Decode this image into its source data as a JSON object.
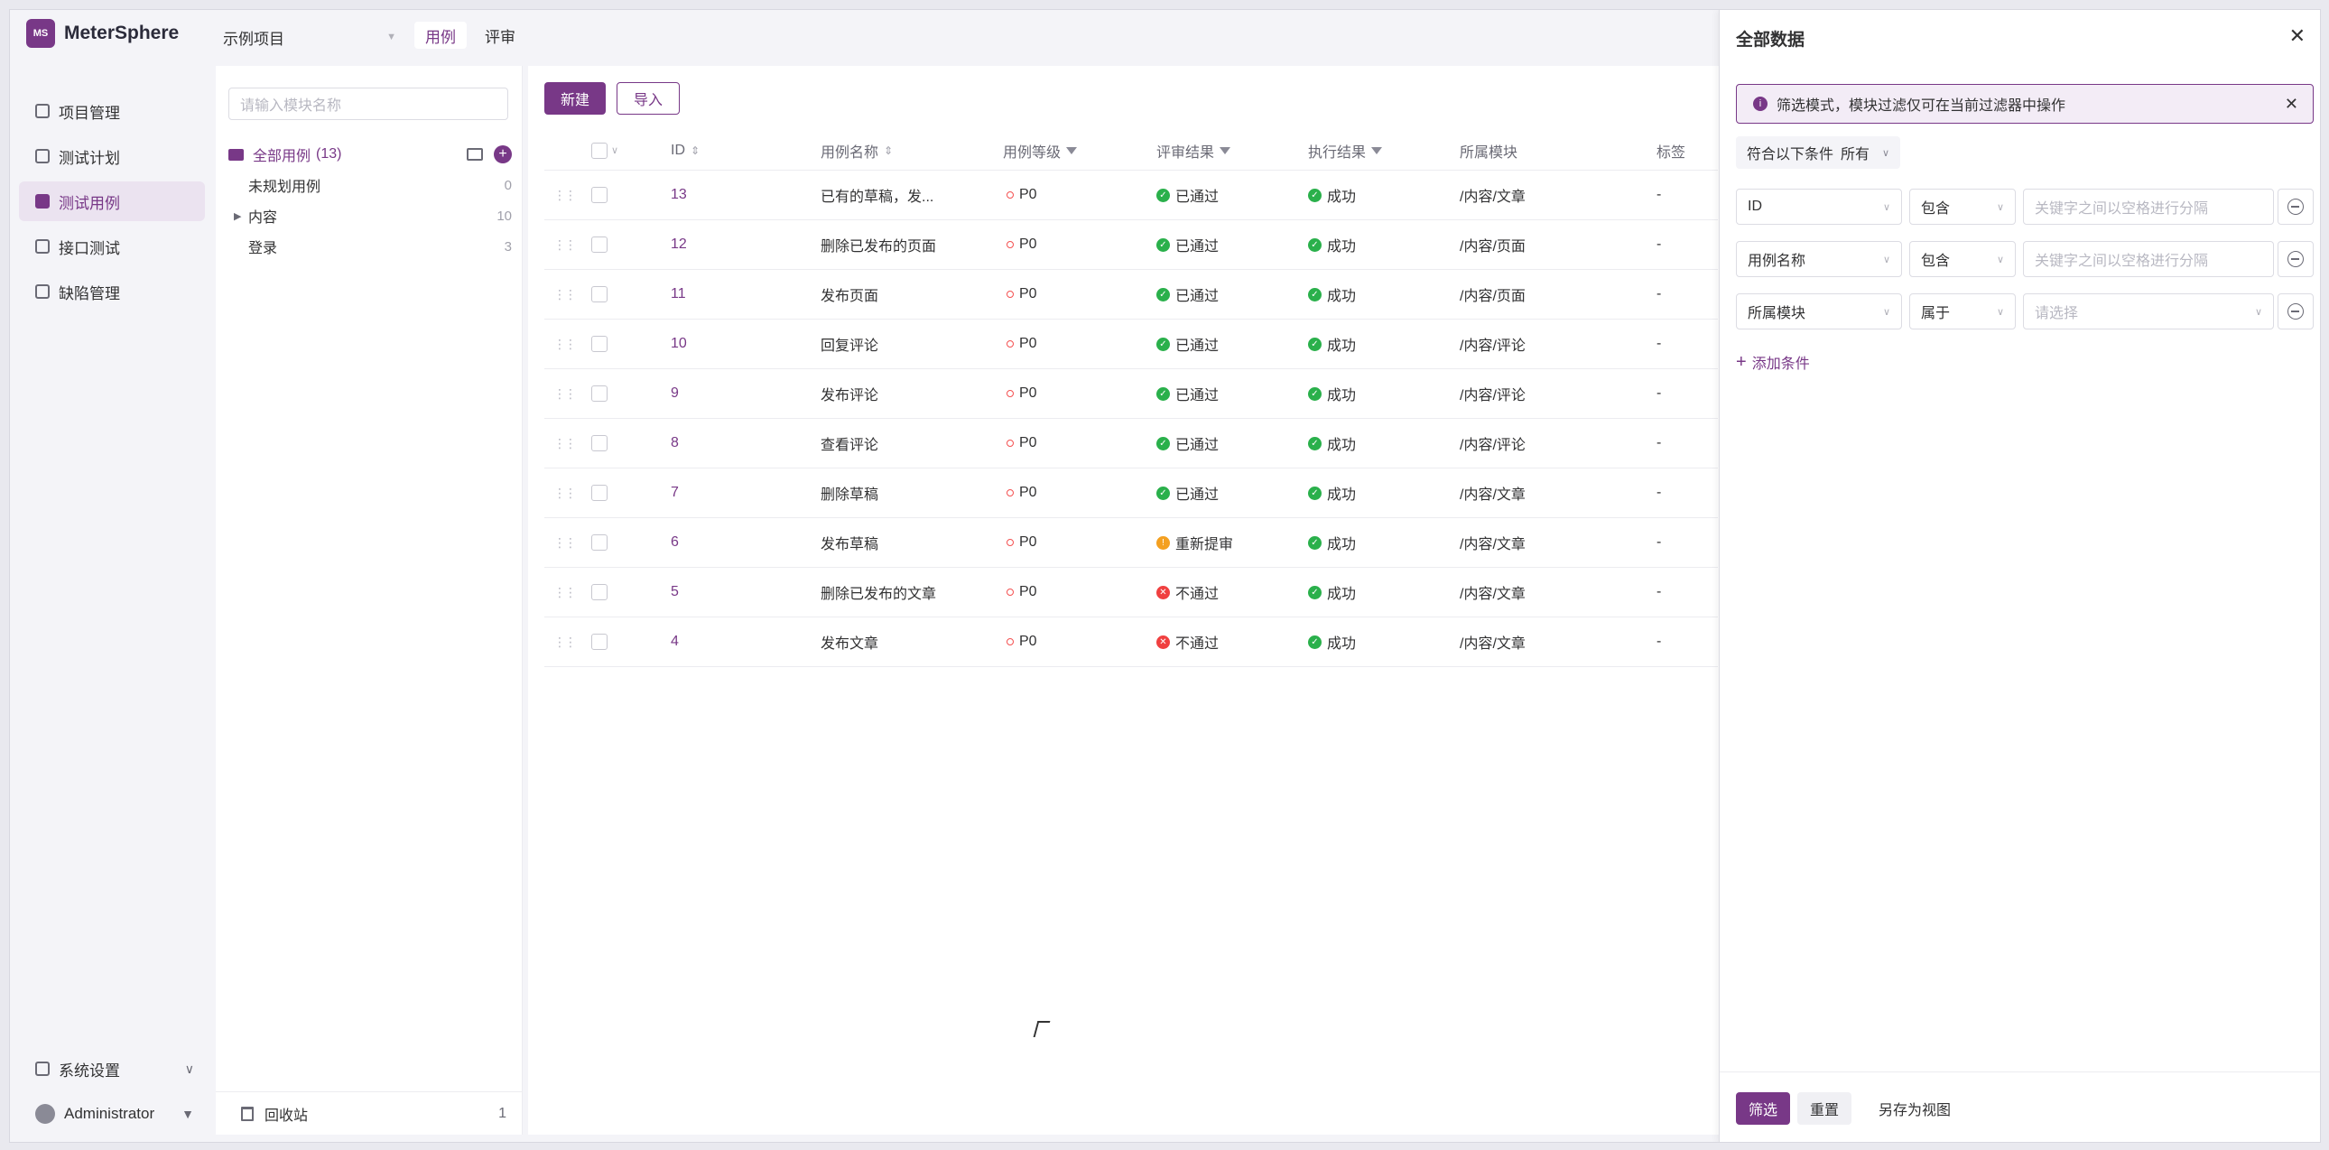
{
  "app": {
    "name": "MeterSphere",
    "logo_text": "MS"
  },
  "header": {
    "project": "示例项目",
    "tabs": [
      {
        "label": "用例"
      },
      {
        "label": "评审"
      }
    ]
  },
  "sidebar": {
    "items": [
      {
        "label": "项目管理"
      },
      {
        "label": "测试计划"
      },
      {
        "label": "测试用例"
      },
      {
        "label": "接口测试"
      },
      {
        "label": "缺陷管理"
      }
    ],
    "settings_label": "系统设置",
    "user": "Administrator"
  },
  "modules": {
    "search_placeholder": "请输入模块名称",
    "all_label": "全部用例",
    "all_count": "(13)",
    "items": [
      {
        "label": "未规划用例",
        "count": "0"
      },
      {
        "label": "内容",
        "count": "10"
      },
      {
        "label": "登录",
        "count": "3"
      }
    ],
    "recycle_label": "回收站",
    "recycle_count": "1"
  },
  "cases": {
    "new_label": "新建",
    "import_label": "导入",
    "columns": {
      "id": "ID",
      "name": "用例名称",
      "level": "用例等级",
      "review": "评审结果",
      "exec": "执行结果",
      "module": "所属模块",
      "tag": "标签"
    },
    "rows": [
      {
        "id": "13",
        "name": "已有的草稿，发...",
        "level": "P0",
        "review": "已通过",
        "exec": "成功",
        "module": "/内容/文章",
        "tag": "-"
      },
      {
        "id": "12",
        "name": "删除已发布的页面",
        "level": "P0",
        "review": "已通过",
        "exec": "成功",
        "module": "/内容/页面",
        "tag": "-"
      },
      {
        "id": "11",
        "name": "发布页面",
        "level": "P0",
        "review": "已通过",
        "exec": "成功",
        "module": "/内容/页面",
        "tag": "-"
      },
      {
        "id": "10",
        "name": "回复评论",
        "level": "P0",
        "review": "已通过",
        "exec": "成功",
        "module": "/内容/评论",
        "tag": "-"
      },
      {
        "id": "9",
        "name": "发布评论",
        "level": "P0",
        "review": "已通过",
        "exec": "成功",
        "module": "/内容/评论",
        "tag": "-"
      },
      {
        "id": "8",
        "name": "查看评论",
        "level": "P0",
        "review": "已通过",
        "exec": "成功",
        "module": "/内容/评论",
        "tag": "-"
      },
      {
        "id": "7",
        "name": "删除草稿",
        "level": "P0",
        "review": "已通过",
        "exec": "成功",
        "module": "/内容/文章",
        "tag": "-"
      },
      {
        "id": "6",
        "name": "发布草稿",
        "level": "P0",
        "review": "重新提审",
        "exec": "成功",
        "module": "/内容/文章",
        "tag": "-"
      },
      {
        "id": "5",
        "name": "删除已发布的文章",
        "level": "P0",
        "review": "不通过",
        "exec": "成功",
        "module": "/内容/文章",
        "tag": "-"
      },
      {
        "id": "4",
        "name": "发布文章",
        "level": "P0",
        "review": "不通过",
        "exec": "成功",
        "module": "/内容/文章",
        "tag": "-"
      }
    ]
  },
  "filter": {
    "title": "全部数据",
    "alert": "筛选模式，模块过滤仅可在当前过滤器中操作",
    "match_label": "符合以下条件",
    "match_value": "所有",
    "conditions": [
      {
        "field": "ID",
        "op": "包含",
        "value_placeholder": "关键字之间以空格进行分隔"
      },
      {
        "field": "用例名称",
        "op": "包含",
        "value_placeholder": "关键字之间以空格进行分隔"
      },
      {
        "field": "所属模块",
        "op": "属于",
        "value_placeholder": "请选择"
      }
    ],
    "add_label": "添加条件",
    "filter_btn": "筛选",
    "reset_btn": "重置",
    "save_view_btn": "另存为视图"
  },
  "colors": {
    "accent": "#783887",
    "success": "#2ab04b",
    "warn": "#f4a020",
    "danger": "#f04040"
  }
}
